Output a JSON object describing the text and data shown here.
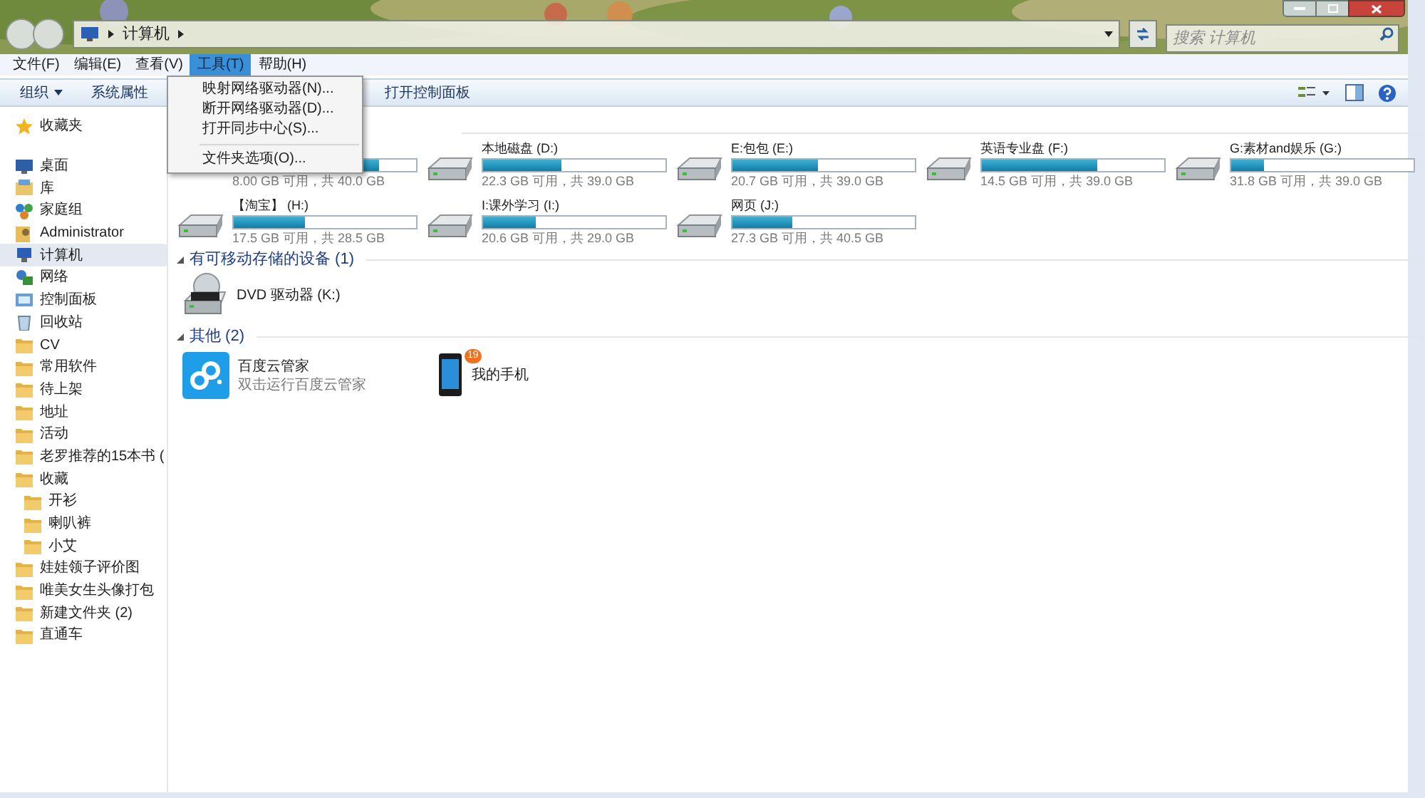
{
  "address_bar": {
    "crumbs": [
      "计算机"
    ]
  },
  "search": {
    "placeholder": "搜索 计算机"
  },
  "menu_bar": [
    {
      "label": "文件(F)",
      "selected": false
    },
    {
      "label": "编辑(E)",
      "selected": false
    },
    {
      "label": "查看(V)",
      "selected": false
    },
    {
      "label": "工具(T)",
      "selected": true
    },
    {
      "label": "帮助(H)",
      "selected": false
    }
  ],
  "toolbar": {
    "left": [
      "组织",
      "系统属性"
    ],
    "right_item": "打开控制面板"
  },
  "tools_menu": [
    {
      "label": "映射网络驱动器(N)..."
    },
    {
      "label": "断开网络驱动器(D)..."
    },
    {
      "label": "打开同步中心(S)..."
    },
    {
      "kind": "separator"
    },
    {
      "label": "文件夹选项(O)..."
    }
  ],
  "sidebar": [
    {
      "kind": "star",
      "label": "收藏夹",
      "selected": false
    },
    {
      "kind": "desktop",
      "label": "桌面",
      "selected": false
    },
    {
      "kind": "library",
      "label": "库",
      "selected": false
    },
    {
      "kind": "homegroup",
      "label": "家庭组",
      "selected": false
    },
    {
      "kind": "user",
      "label": "Administrator",
      "selected": false
    },
    {
      "kind": "computer",
      "label": "计算机",
      "selected": true
    },
    {
      "kind": "network",
      "label": "网络",
      "selected": false
    },
    {
      "kind": "control",
      "label": "控制面板",
      "selected": false
    },
    {
      "kind": "recycle",
      "label": "回收站",
      "selected": false
    },
    {
      "kind": "folder",
      "label": "CV",
      "selected": false
    },
    {
      "kind": "folder",
      "label": "常用软件",
      "selected": false
    },
    {
      "kind": "folder",
      "label": "待上架",
      "selected": false
    },
    {
      "kind": "folder",
      "label": "地址",
      "selected": false
    },
    {
      "kind": "folder",
      "label": "活动",
      "selected": false
    },
    {
      "kind": "folder",
      "label": "老罗推荐的15本书 (",
      "selected": false
    },
    {
      "kind": "folder",
      "label": "收藏",
      "selected": false,
      "children": [
        {
          "kind": "folder",
          "label": "开衫",
          "selected": false
        },
        {
          "kind": "folder",
          "label": "喇叭裤",
          "selected": false
        },
        {
          "kind": "folder",
          "label": "小艾",
          "selected": false
        }
      ]
    },
    {
      "kind": "folder",
      "label": "娃娃领子评价图",
      "selected": false
    },
    {
      "kind": "folder",
      "label": "唯美女生头像打包",
      "selected": false
    },
    {
      "kind": "folder",
      "label": "新建文件夹 (2)",
      "selected": false
    },
    {
      "kind": "folder",
      "label": "直通车",
      "selected": false
    }
  ],
  "drives": [
    {
      "level": 0.8,
      "info": "8.00 GB 可用，共 40.0 GB"
    },
    {
      "name": "本地磁盘 (D:)",
      "level": 0.43,
      "info": "22.3 GB 可用，共 39.0 GB"
    },
    {
      "name": "E:包包 (E:)",
      "level": 0.47,
      "info": "20.7 GB 可用，共 39.0 GB"
    },
    {
      "name": "英语专业盘 (F:)",
      "level": 0.63,
      "info": "14.5 GB 可用，共 39.0 GB"
    },
    {
      "name": "G:素材and娱乐 (G:)",
      "level": 0.18,
      "info": "31.8 GB 可用，共 39.0 GB"
    },
    {
      "name": "【淘宝】 (H:)",
      "level": 0.39,
      "info": "17.5 GB 可用，共 28.5 GB"
    },
    {
      "name": "I:课外学习 (I:)",
      "level": 0.29,
      "info": "20.6 GB 可用，共 29.0 GB"
    },
    {
      "name": "网页 (J:)",
      "level": 0.33,
      "info": "27.3 GB 可用，共 40.5 GB"
    }
  ],
  "removable": {
    "title": "有可移动存储的设备 (1)",
    "items": [
      {
        "name": "DVD 驱动器 (K:)"
      }
    ]
  },
  "other": {
    "title": "其他 (2)",
    "items": [
      {
        "kind": "baidu",
        "name": "百度云管家",
        "subtitle": "双击运行百度云管家"
      },
      {
        "kind": "phone",
        "name": "我的手机",
        "badge": "19"
      }
    ]
  }
}
